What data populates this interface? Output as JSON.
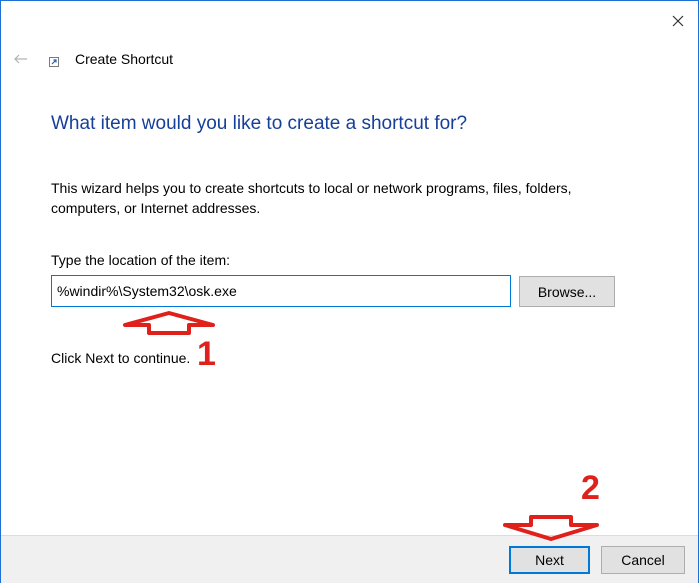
{
  "window": {
    "title": "Create Shortcut"
  },
  "wizard": {
    "heading": "What item would you like to create a shortcut for?",
    "description": "This wizard helps you to create shortcuts to local or network programs, files, folders, computers, or Internet addresses.",
    "field_label": "Type the location of the item:",
    "location_value": "%windir%\\System32\\osk.exe",
    "browse_label": "Browse...",
    "continue_text": "Click Next to continue."
  },
  "annotations": {
    "step1": "1",
    "step2": "2",
    "color": "#e0201a"
  },
  "footer": {
    "next_label": "Next",
    "cancel_label": "Cancel"
  },
  "icons": {
    "close": "close-icon",
    "back": "back-arrow-icon",
    "app": "shortcut-icon"
  },
  "colors": {
    "accent": "#0078d7",
    "heading": "#163f9a"
  }
}
